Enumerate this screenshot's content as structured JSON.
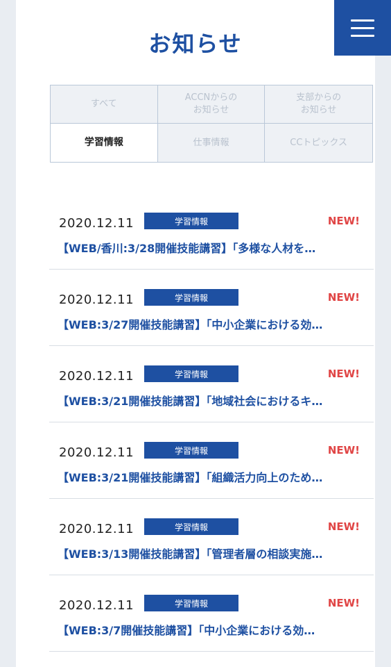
{
  "header": {
    "title": "お知らせ",
    "menu_icon": "hamburger-menu-icon"
  },
  "tabs": [
    {
      "label": "すべて",
      "active": false
    },
    {
      "label": "ACCNからの\nお知らせ",
      "active": false
    },
    {
      "label": "支部からの\nお知らせ",
      "active": false
    },
    {
      "label": "学習情報",
      "active": true
    },
    {
      "label": "仕事情報",
      "active": false
    },
    {
      "label": "CCトピックス",
      "active": false
    }
  ],
  "news": [
    {
      "date": "2020.12.11",
      "category": "学習情報",
      "badge": "NEW!",
      "title": "【WEB/香川:3/28開催技能講習】「多様な人材を…"
    },
    {
      "date": "2020.12.11",
      "category": "学習情報",
      "badge": "NEW!",
      "title": "【WEB:3/27開催技能講習】「中小企業における効…"
    },
    {
      "date": "2020.12.11",
      "category": "学習情報",
      "badge": "NEW!",
      "title": "【WEB:3/21開催技能講習】「地域社会におけるキ…"
    },
    {
      "date": "2020.12.11",
      "category": "学習情報",
      "badge": "NEW!",
      "title": "【WEB:3/21開催技能講習】「組織活力向上のため…"
    },
    {
      "date": "2020.12.11",
      "category": "学習情報",
      "badge": "NEW!",
      "title": "【WEB:3/13開催技能講習】「管理者層の相談実施…"
    },
    {
      "date": "2020.12.11",
      "category": "学習情報",
      "badge": "NEW!",
      "title": "【WEB:3/7開催技能講習】「中小企業における効…"
    }
  ],
  "colors": {
    "brand": "#1e50a2",
    "new": "#e04545"
  }
}
